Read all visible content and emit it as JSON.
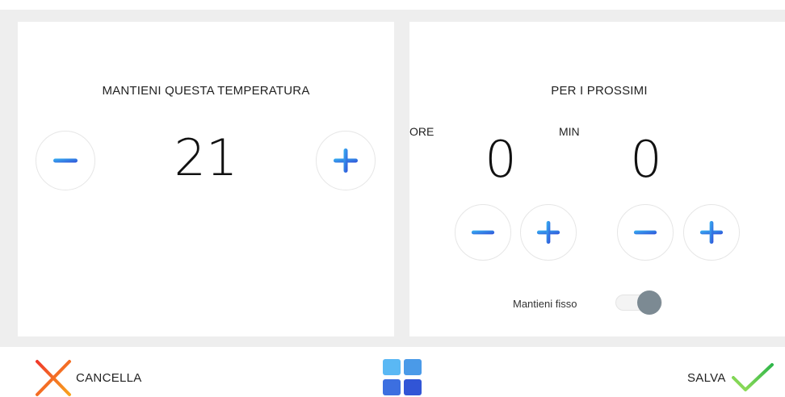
{
  "temperature_panel": {
    "title": "MANTIENI QUESTA TEMPERATURA",
    "value": "21"
  },
  "duration_panel": {
    "title": "PER I PROSSIMI",
    "hours_label": "ORE",
    "hours_value": "0",
    "minutes_label": "MIN",
    "minutes_value": "0"
  },
  "toggle": {
    "label": "Mantieni fisso",
    "state": "on"
  },
  "footer": {
    "cancel_label": "CANCELLA",
    "save_label": "SALVA"
  },
  "colors": {
    "accent_blue": "#2f5fe0",
    "accent_cyan": "#39b4f2",
    "cancel_red": "#e8452c",
    "cancel_orange": "#f7a31e",
    "save_green": "#5ec94b",
    "toggle_knob": "#7c8a93"
  },
  "icons": {
    "minus": "minus-icon",
    "plus": "plus-icon",
    "cancel": "close-x-icon",
    "save": "checkmark-icon",
    "home": "grid-menu-icon"
  }
}
